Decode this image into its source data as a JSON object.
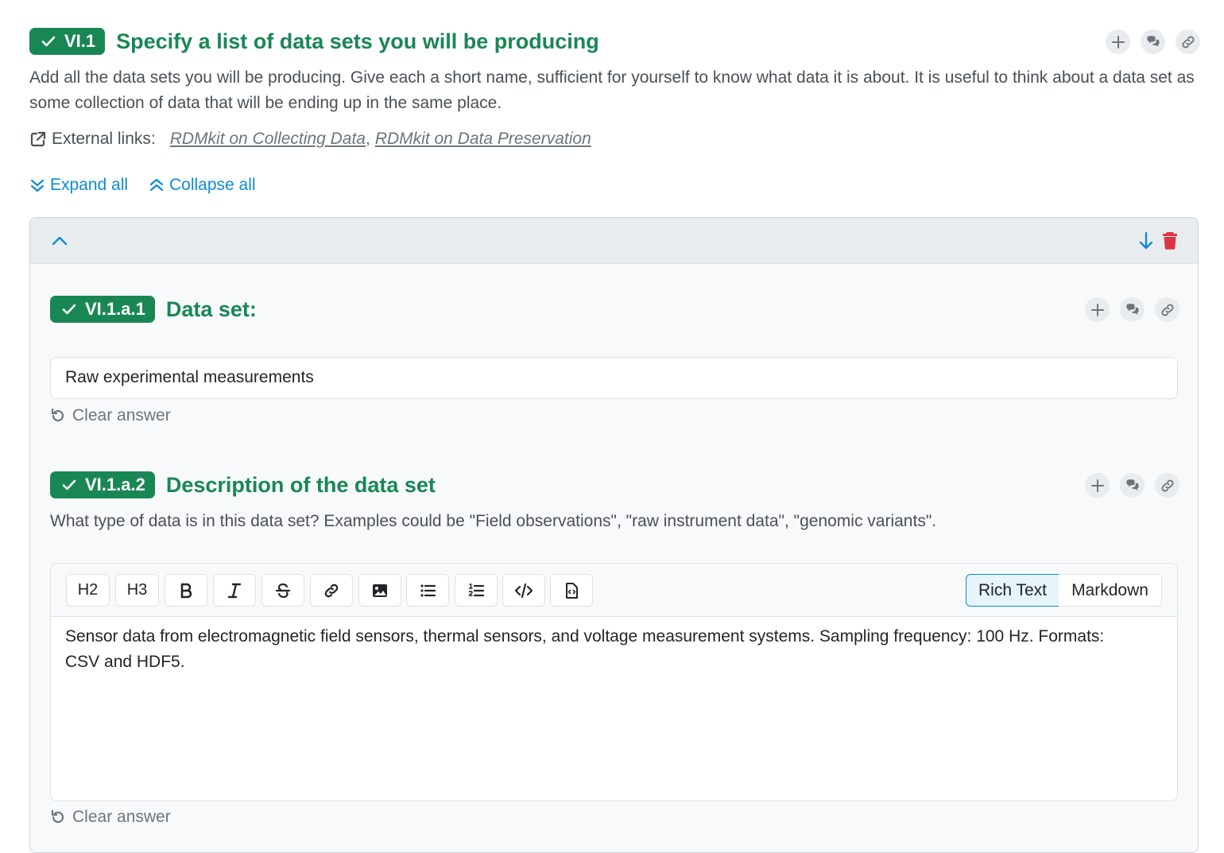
{
  "question": {
    "badge": "VI.1",
    "title": "Specify a list of data sets you will be producing",
    "description": "Add all the data sets you will be producing. Give each a short name, sufficient for yourself to know what data it is about. It is useful to think about a data set as some collection of data that will be ending up in the same place.",
    "external_links_label": "External links:",
    "links": [
      "RDMkit on Collecting Data",
      "RDMkit on Data Preservation"
    ],
    "link_separator": ","
  },
  "controls": {
    "expand_all": "Expand all",
    "collapse_all": "Collapse all"
  },
  "item": {
    "q1": {
      "badge": "VI.1.a.1",
      "title": "Data set:",
      "value": "Raw experimental measurements",
      "clear_label": "Clear answer"
    },
    "q2": {
      "badge": "VI.1.a.2",
      "title": "Description of the data set",
      "description": "What type of data is in this data set? Examples could be \"Field observations\", \"raw instrument data\", \"genomic variants\".",
      "toolbar": {
        "h2": "H2",
        "h3": "H3"
      },
      "modes": {
        "rich": "Rich Text",
        "markdown": "Markdown"
      },
      "content": "Sensor data from electromagnetic field sensors, thermal sensors, and voltage measurement systems. Sampling frequency: 100 Hz. Formats: CSV and HDF5."
    }
  },
  "colors": {
    "accent_green": "#198754",
    "link_blue": "#0d8bd6",
    "danger_red": "#dc3545"
  }
}
